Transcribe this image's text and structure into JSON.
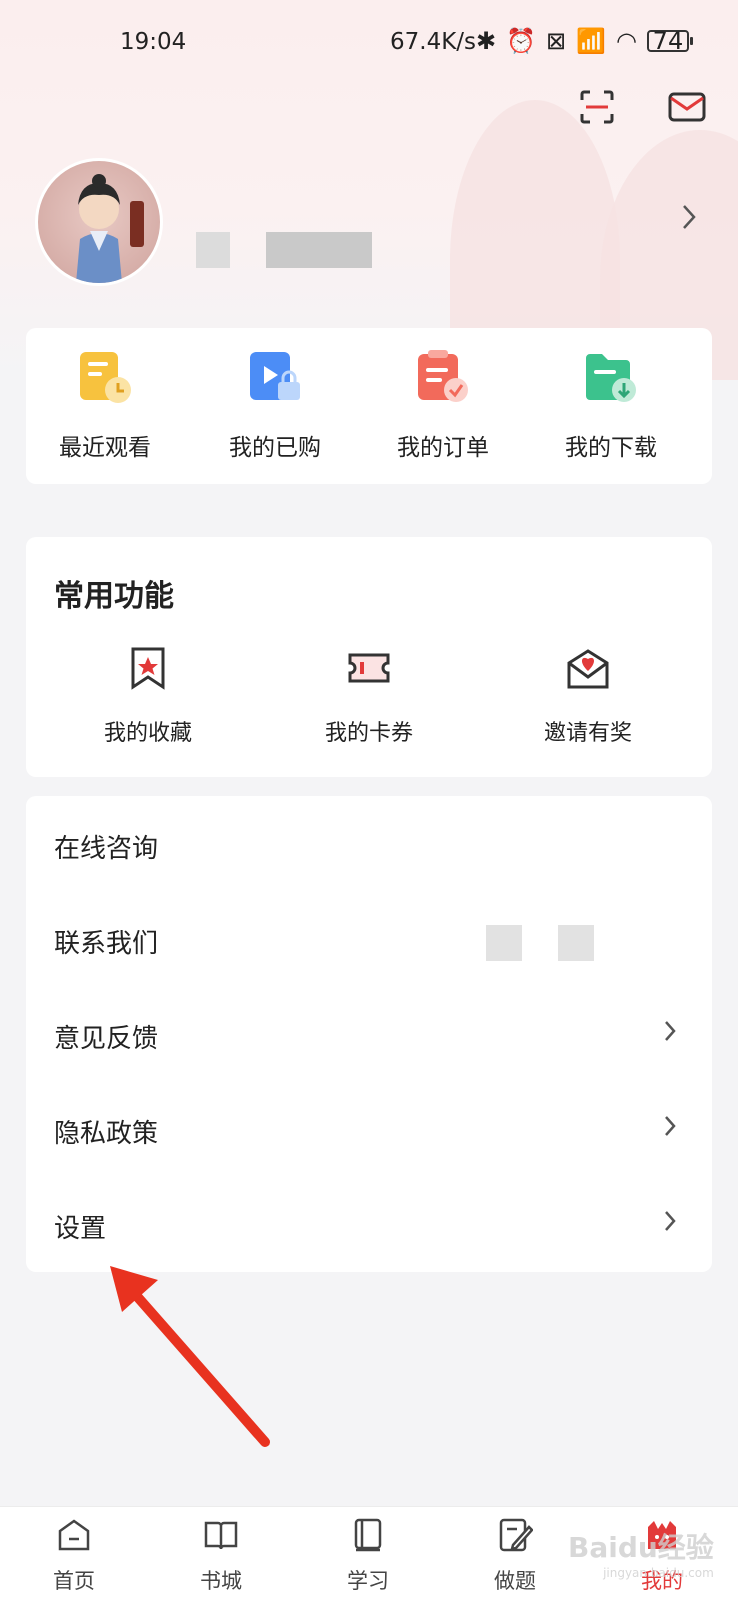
{
  "status_bar": {
    "time": "19:04",
    "network_speed": "67.4K/s",
    "battery": "74"
  },
  "quick_actions": [
    {
      "label": "最近观看",
      "icon": "recent-view-icon",
      "color": "#f7c23e"
    },
    {
      "label": "我的已购",
      "icon": "purchased-icon",
      "color": "#4c8df6"
    },
    {
      "label": "我的订单",
      "icon": "order-icon",
      "color": "#f26a5b"
    },
    {
      "label": "我的下载",
      "icon": "download-icon",
      "color": "#3cc28d"
    }
  ],
  "common_functions": {
    "title": "常用功能",
    "items": [
      {
        "label": "我的收藏",
        "icon": "favorite-icon"
      },
      {
        "label": "我的卡券",
        "icon": "coupon-icon"
      },
      {
        "label": "邀请有奖",
        "icon": "invite-icon"
      }
    ]
  },
  "menu": [
    {
      "label": "在线咨询",
      "has_chevron": false
    },
    {
      "label": "联系我们",
      "has_chevron": false
    },
    {
      "label": "意见反馈",
      "has_chevron": true
    },
    {
      "label": "隐私政策",
      "has_chevron": true
    },
    {
      "label": "设置",
      "has_chevron": true
    }
  ],
  "bottom_nav": [
    {
      "label": "首页",
      "icon": "home-icon",
      "active": false
    },
    {
      "label": "书城",
      "icon": "book-icon",
      "active": false
    },
    {
      "label": "学习",
      "icon": "study-icon",
      "active": false
    },
    {
      "label": "做题",
      "icon": "exercise-icon",
      "active": false
    },
    {
      "label": "我的",
      "icon": "profile-icon",
      "active": true
    }
  ],
  "colors": {
    "accent": "#e23a3a",
    "background": "#f4f4f6"
  },
  "watermark": {
    "main": "Baidu经验",
    "sub": "jingyan.baidu.com"
  }
}
